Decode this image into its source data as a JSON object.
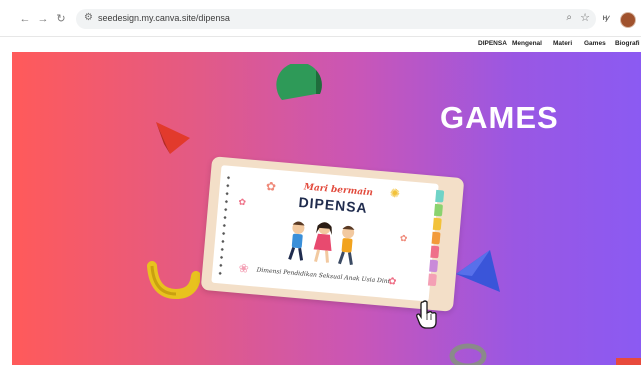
{
  "browser": {
    "url": "seedesign.my.canva.site/dipensa",
    "icons": [
      "back-icon",
      "forward-icon",
      "reload-icon",
      "site-settings-icon",
      "zoom-icon",
      "bookmark-star-icon",
      "extension-icon",
      "profile-avatar"
    ],
    "extension_label": "ᴴ∕"
  },
  "site_nav": {
    "items": [
      "DIPENSA",
      "Mengenal",
      "Materi",
      "Games",
      "Biografi"
    ]
  },
  "hero": {
    "title": "GAMES",
    "notebook": {
      "line1": "Mari bermain",
      "line2": "DIPENSA",
      "subtitle": "Dimensi Pendidikan Seksual Anak Usia Dini"
    }
  },
  "colors": {
    "gradient_left": "#ff5a5a",
    "gradient_right": "#8b5af2",
    "title_text": "#ffffff",
    "green_shape": "#2e9a58",
    "red_shape": "#e23a2c",
    "yellow_shape": "#e8c21e",
    "blue_shape": "#3a55d9"
  }
}
